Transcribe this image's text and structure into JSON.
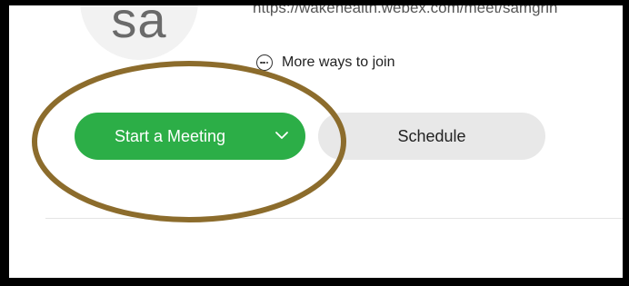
{
  "profile": {
    "avatar_initials": "sa",
    "meeting_link": "https://wakehealth.webex.com/meet/samgrin"
  },
  "join": {
    "more_ways_label": "More ways to join",
    "icon": "more-horizontal-circle-icon"
  },
  "actions": {
    "start_meeting_label": "Start a Meeting",
    "start_meeting_dropdown_icon": "chevron-down-icon",
    "schedule_label": "Schedule"
  },
  "colors": {
    "start_button": "#2cae47",
    "schedule_button": "#e8e8e8",
    "annotation_ellipse": "#8c6c2c",
    "frame_border": "#000000"
  }
}
